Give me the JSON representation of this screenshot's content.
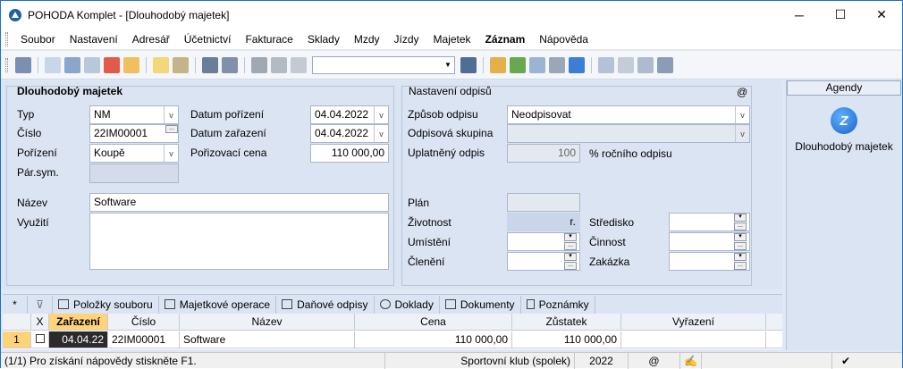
{
  "window": {
    "title": "POHODA Komplet - [Dlouhodobý majetek]"
  },
  "menu": [
    "Soubor",
    "Nastavení",
    "Adresář",
    "Účetnictví",
    "Fakturace",
    "Sklady",
    "Mzdy",
    "Jízdy",
    "Majetek",
    "Záznam",
    "Nápověda"
  ],
  "toolbar": {
    "combo_value": ""
  },
  "form": {
    "section_title": "Dlouhodobý majetek",
    "typ_label": "Typ",
    "typ_value": "NM",
    "cislo_label": "Číslo",
    "cislo_value": "22IM00001",
    "porizeni_label": "Pořízení",
    "porizeni_value": "Koupě",
    "parsym_label": "Pár.sym.",
    "datum_porizeni_label": "Datum pořízení",
    "datum_porizeni_value": "04.04.2022",
    "datum_zarazeni_label": "Datum zařazení",
    "datum_zarazeni_value": "04.04.2022",
    "porizovaci_cena_label": "Pořizovací cena",
    "porizovaci_cena_value": "110 000,00",
    "nazev_label": "Název",
    "nazev_value": "Software",
    "vyuziti_label": "Využití",
    "depr_title": "Nastavení odpisů",
    "at_sign": "@",
    "zpusob_label": "Způsob odpisu",
    "zpusob_value": "Neodpisovat",
    "skupina_label": "Odpisová skupina",
    "uplatneny_label": "Uplatněný odpis",
    "uplatneny_value": "100",
    "uplatneny_suffix": "% ročního odpisu",
    "plan_label": "Plán",
    "zivotnost_label": "Životnost",
    "zivotnost_suffix": "r.",
    "umisteni_label": "Umístění",
    "cleneni_label": "Členění",
    "stredisko_label": "Středisko",
    "cinnost_label": "Činnost",
    "zakazka_label": "Zakázka"
  },
  "sidebar": {
    "header": "Agendy",
    "item_label": "Dlouhodobý majetek"
  },
  "tabs": [
    "Položky souboru",
    "Majetkové operace",
    "Daňové odpisy",
    "Doklady",
    "Dokumenty",
    "Poznámky"
  ],
  "grid": {
    "columns": [
      "X",
      "Zařazení",
      "Číslo",
      "Název",
      "Cena",
      "Zůstatek",
      "Vyřazení"
    ],
    "rows": [
      {
        "num": "1",
        "zarazeni": "04.04.22",
        "cislo": "22IM00001",
        "nazev": "Software",
        "cena": "110 000,00",
        "zustatek": "110 000,00",
        "vyrazeni": ""
      }
    ]
  },
  "status": {
    "hint": "(1/1) Pro získání nápovědy stiskněte F1.",
    "company": "Sportovní klub (spolek)",
    "year": "2022",
    "at": "@"
  },
  "colors": {
    "accent": "#1a6fc9",
    "panel": "#dbe4f2",
    "selected_cell": "#2b2b2b",
    "highlight": "#ffd37a"
  }
}
